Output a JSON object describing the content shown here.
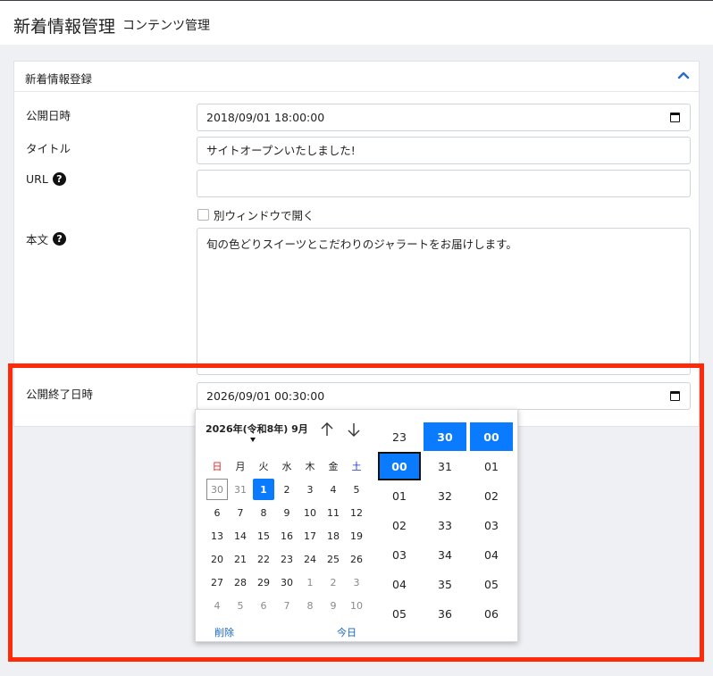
{
  "header": {
    "title": "新着情報管理",
    "subtitle": "コンテンツ管理"
  },
  "card": {
    "title": "新着情報登録"
  },
  "form": {
    "publish_label": "公開日時",
    "publish_value": "2018/09/01 18:00:00",
    "title_label": "タイトル",
    "title_value": "サイトオープンいたしました!",
    "url_label": "URL",
    "url_value": "",
    "new_window_label": "別ウィンドウで開く",
    "body_label": "本文",
    "body_value": "旬の色どりスイーツとこだわりのジャラートをお届けします。",
    "end_label": "公開終了日時",
    "end_value": "2026/09/01 00:30:00"
  },
  "picker": {
    "month_label": "2026年(令和8年) 9月",
    "weekdays": [
      "日",
      "月",
      "火",
      "水",
      "木",
      "金",
      "土"
    ],
    "weekday_colors": {
      "sun": "#e02020",
      "sat": "#2030d0"
    },
    "days": [
      [
        "30",
        "31",
        "1",
        "2",
        "3",
        "4",
        "5"
      ],
      [
        "6",
        "7",
        "8",
        "9",
        "10",
        "11",
        "12"
      ],
      [
        "13",
        "14",
        "15",
        "16",
        "17",
        "18",
        "19"
      ],
      [
        "20",
        "21",
        "22",
        "23",
        "24",
        "25",
        "26"
      ],
      [
        "27",
        "28",
        "29",
        "30",
        "1",
        "2",
        "3"
      ],
      [
        "4",
        "5",
        "6",
        "7",
        "8",
        "9",
        "10"
      ]
    ],
    "selected_day": "1",
    "clear_label": "削除",
    "today_label": "今日",
    "hours": [
      "23",
      "00",
      "01",
      "02",
      "03",
      "04",
      "05"
    ],
    "minutes": [
      "30",
      "31",
      "32",
      "33",
      "34",
      "35",
      "36"
    ],
    "seconds": [
      "00",
      "01",
      "02",
      "03",
      "04",
      "05",
      "06"
    ],
    "accent": "#0a7bff"
  }
}
